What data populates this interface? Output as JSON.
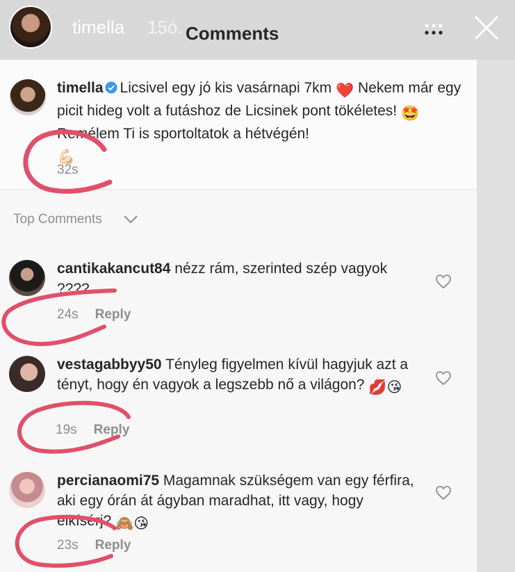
{
  "story": {
    "username": "timella",
    "time": "15ó."
  },
  "sheet": {
    "title": "Comments"
  },
  "caption": {
    "username": "timella",
    "text": "Licsivel egy jó kis vasárnapi 7km",
    "emoji_heart": "❤️",
    "text2": "Nekem már egy picit hideg volt a futáshoz de Licsinek pont tökéletes!",
    "emoji_star": "🤩",
    "text3": "Remélem Ti is sportoltatok a hétvégén!",
    "emoji_tail": "💪🏻",
    "time": "32s"
  },
  "section": {
    "label": "Top Comments"
  },
  "comments": [
    {
      "username": "cantikakancut84",
      "text": "nézz rám, szerinted szép vagyok ????",
      "time": "24s",
      "reply": "Reply"
    },
    {
      "username": "vestagabbyy50",
      "text": "Tényleg figyelmen kívül hagyjuk azt a tényt, hogy én vagyok a legszebb nő a világon?",
      "emoji": "💋😘",
      "time": "19s",
      "reply": "Reply"
    },
    {
      "username": "percianaomi75",
      "text": "Magamnak szükségem van egy férfira, aki egy órán át ágyban maradhat, itt vagy, hogy elkísérj?",
      "emoji": "🙈😘",
      "time": "23s",
      "reply": "Reply"
    }
  ],
  "colors": {
    "annotation": "#e0506a",
    "verified": "#3897f0",
    "muted": "#8e8e8e"
  }
}
